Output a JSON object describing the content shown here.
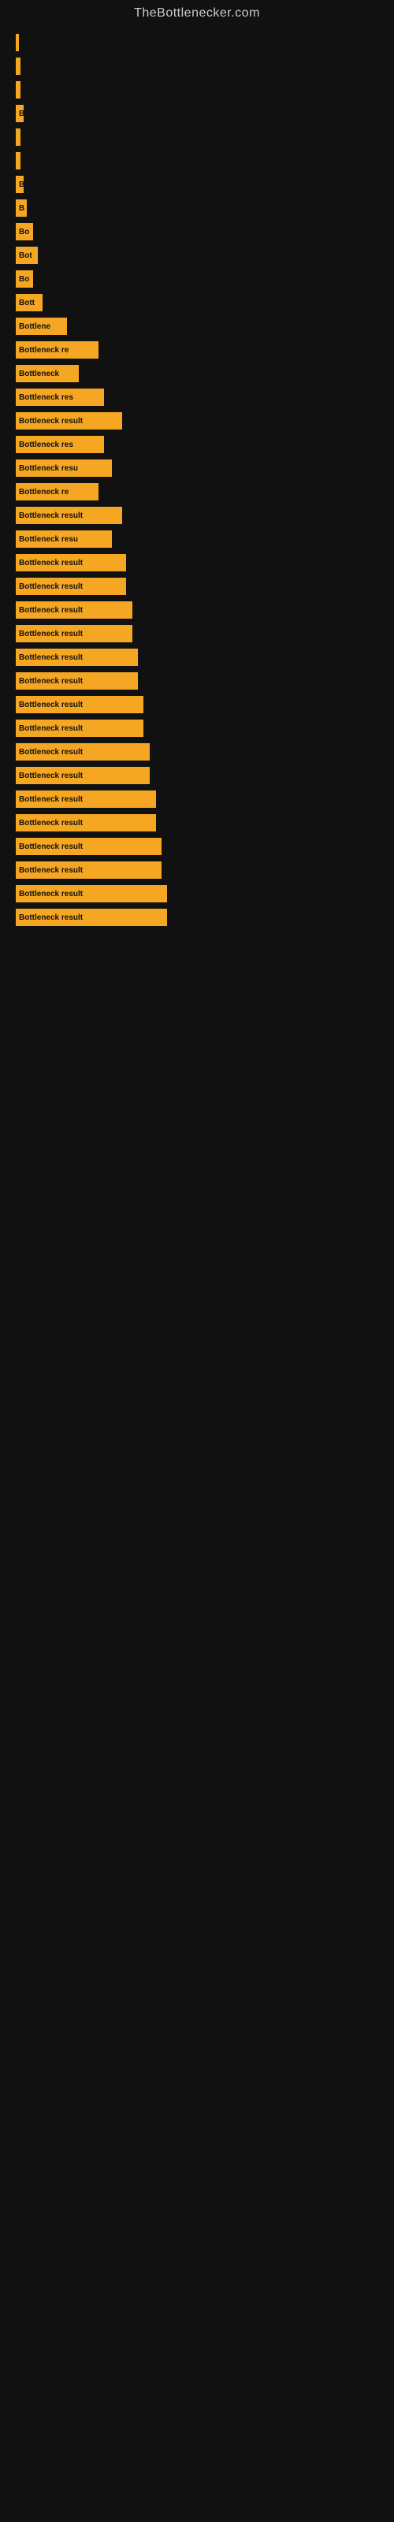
{
  "site": {
    "title": "TheBottlenecker.com"
  },
  "bars": [
    {
      "label": "",
      "width": 4
    },
    {
      "label": "",
      "width": 6
    },
    {
      "label": "",
      "width": 6
    },
    {
      "label": "B",
      "width": 10
    },
    {
      "label": "",
      "width": 6
    },
    {
      "label": "",
      "width": 6
    },
    {
      "label": "B",
      "width": 10
    },
    {
      "label": "B",
      "width": 14
    },
    {
      "label": "Bo",
      "width": 22
    },
    {
      "label": "Bot",
      "width": 28
    },
    {
      "label": "Bo",
      "width": 22
    },
    {
      "label": "Bott",
      "width": 34
    },
    {
      "label": "Bottlene",
      "width": 65
    },
    {
      "label": "Bottleneck re",
      "width": 105
    },
    {
      "label": "Bottleneck",
      "width": 80
    },
    {
      "label": "Bottleneck res",
      "width": 112
    },
    {
      "label": "Bottleneck result",
      "width": 135
    },
    {
      "label": "Bottleneck res",
      "width": 112
    },
    {
      "label": "Bottleneck resu",
      "width": 122
    },
    {
      "label": "Bottleneck re",
      "width": 105
    },
    {
      "label": "Bottleneck result",
      "width": 135
    },
    {
      "label": "Bottleneck resu",
      "width": 122
    },
    {
      "label": "Bottleneck result",
      "width": 140
    },
    {
      "label": "Bottleneck result",
      "width": 140
    },
    {
      "label": "Bottleneck result",
      "width": 148
    },
    {
      "label": "Bottleneck result",
      "width": 148
    },
    {
      "label": "Bottleneck result",
      "width": 155
    },
    {
      "label": "Bottleneck result",
      "width": 155
    },
    {
      "label": "Bottleneck result",
      "width": 162
    },
    {
      "label": "Bottleneck result",
      "width": 162
    },
    {
      "label": "Bottleneck result",
      "width": 170
    },
    {
      "label": "Bottleneck result",
      "width": 170
    },
    {
      "label": "Bottleneck result",
      "width": 178
    },
    {
      "label": "Bottleneck result",
      "width": 178
    },
    {
      "label": "Bottleneck result",
      "width": 185
    },
    {
      "label": "Bottleneck result",
      "width": 185
    },
    {
      "label": "Bottleneck result",
      "width": 192
    },
    {
      "label": "Bottleneck result",
      "width": 192
    }
  ]
}
